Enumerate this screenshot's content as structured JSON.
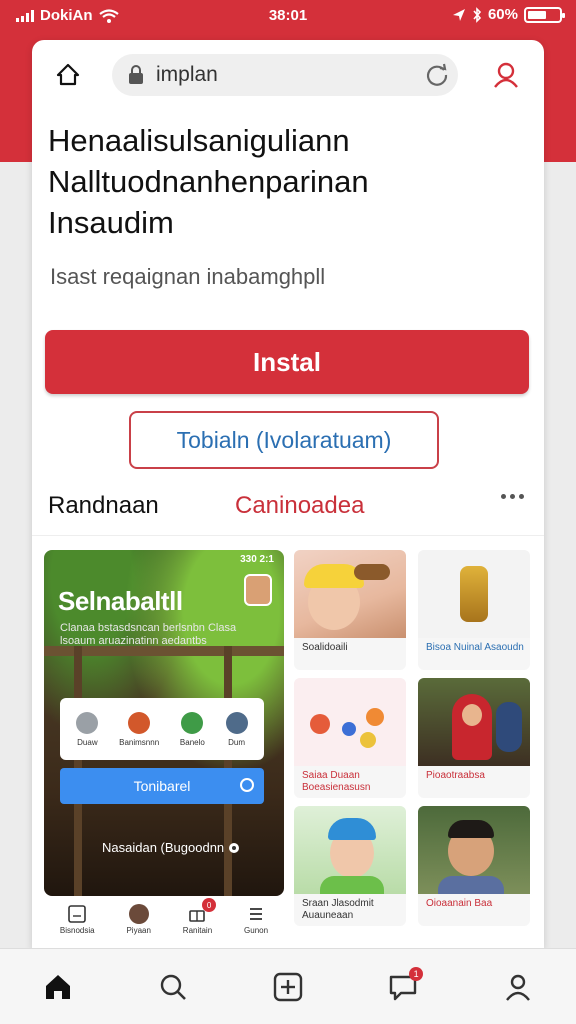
{
  "status_bar": {
    "carrier": "DokiAn",
    "time": "38:01",
    "battery": "60%"
  },
  "browser": {
    "url": "implan"
  },
  "page": {
    "headline_line1": "Henaalisulsaniguliann",
    "headline_line2": "Nalltuodnanhenparinan",
    "headline_line3": "Insaudim",
    "subline": "Isast reqaignan inabamghpll",
    "install_label": "Instal",
    "secondary_label": "Tobialn (Ivolaratuam)",
    "tabs": [
      {
        "label": "Randnaan"
      },
      {
        "label": "Caninoadea"
      }
    ]
  },
  "hero": {
    "title": "Selnabaltll",
    "subtitle": "Clanaa bstasdsncan berlsnbn Clasa lsoaum aruazinatinn aedantbs",
    "badge": "330 2:1",
    "mini_items": [
      {
        "label": "Duaw",
        "color": "#9aa0a6"
      },
      {
        "label": "Banimsnnn",
        "color": "#d2582b"
      },
      {
        "label": "Banelo",
        "color": "#3f9b47"
      },
      {
        "label": "Dum",
        "color": "#4f6b8a"
      }
    ],
    "action_label": "Tonibarel",
    "footer": "Nasaidan (Bugoodnn"
  },
  "tiles": [
    {
      "caption": "Soalidoaili",
      "style": "normal"
    },
    {
      "caption": "Bisoa Nuinal Asaoudn",
      "style": "blue"
    },
    {
      "caption": "Saiaa Duaan Boeasienasusn",
      "style": "red"
    },
    {
      "caption": "Pioaotraabsa",
      "style": "red"
    },
    {
      "caption": "Sraan Jlasodmit Auauneaan",
      "style": "normal"
    },
    {
      "caption": "Oioaanain Baa",
      "style": "red"
    }
  ],
  "shortcuts": [
    {
      "label": "Bisnodsia",
      "icon": "document-icon"
    },
    {
      "label": "Piyaan",
      "icon": "avatar-icon"
    },
    {
      "label": "Ranitain",
      "icon": "gift-icon",
      "badge": "0"
    },
    {
      "label": "Gunon",
      "icon": "list-icon"
    }
  ],
  "bottom_nav": [
    {
      "name": "home",
      "icon": "home-icon"
    },
    {
      "name": "search",
      "icon": "search-icon"
    },
    {
      "name": "add",
      "icon": "add-icon"
    },
    {
      "name": "messages",
      "icon": "chat-icon",
      "badge": "1"
    },
    {
      "name": "profile",
      "icon": "profile-icon"
    }
  ],
  "colors": {
    "brand_red": "#d4303a",
    "link_blue": "#2b6fb2",
    "action_blue": "#3c8ef0"
  }
}
